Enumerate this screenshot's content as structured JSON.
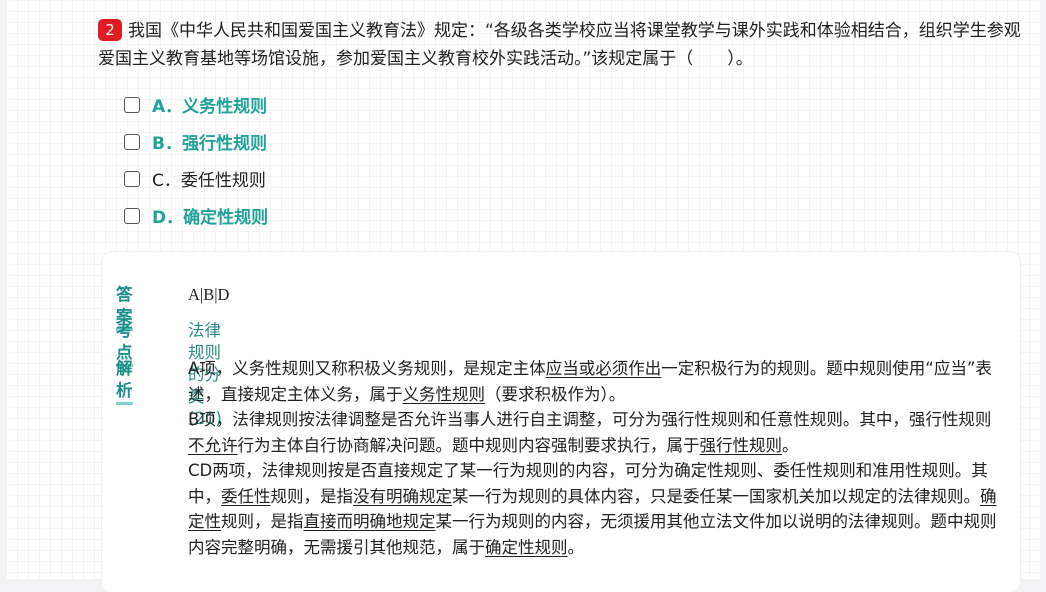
{
  "question": {
    "number": "2",
    "text": "我国《中华人民共和国爱国主义教育法》规定：“各级各类学校应当将课堂教学与课外实践和体验相结合，组织学生参观爱国主义教育基地等场馆设施，参加爱国主义教育校外实践活动。”该规定属于（　　）。"
  },
  "options": [
    {
      "label": "A．义务性规则",
      "correct": true
    },
    {
      "label": "B．强行性规则",
      "correct": true
    },
    {
      "label": "C．委任性规则",
      "correct": false
    },
    {
      "label": "D．确定性规则",
      "correct": true
    }
  ],
  "answer_card": {
    "answer_label": "答案",
    "answer_value": "A|B|D",
    "point_label": "考点",
    "point_value": "法律规则的分类(20)",
    "explain_label": "解析",
    "explain": {
      "p1_a": "A项，义务性规则又称积极义务规则，是规定主体",
      "p1_u1": "应当或必须作出",
      "p1_b": "一定积极行为的规则。题中规则使用“应当”表述，直接规定主体义务，属于",
      "p1_u2": "义务性规则",
      "p1_c": "（要求积极作为）。",
      "p2_a": "B项，法律规则按法律调整是否允许当事人进行自主调整，可分为强行性规则和任意性规则。其中，强行性规则",
      "p2_u1": "不允许",
      "p2_b": "行为主体自行协商解决问题。题中规则内容强制要求执行，属于",
      "p2_u2": "强行性规则",
      "p2_c": "。",
      "p3_a": "CD两项，法律规则按是否直接规定了某一行为规则的内容，可分为确定性规则、委任性规则和准用性规则。其中，",
      "p3_u1": "委任性",
      "p3_b": "规则，是指",
      "p3_u2": "没有明确规定",
      "p3_c": "某一行为规则的具体内容，只是委任某一国家机关加以规定的法律规则。",
      "p3_u3": "确定性",
      "p3_d": "规则，是指",
      "p3_u4": "直接而明确地规定",
      "p3_e": "某一行为规则的内容，无须援用其他立法文件加以说明的法律规则。题中规则内容完整明确，无需援引其他规范，属于",
      "p3_u5": "确定性规则",
      "p3_f": "。"
    }
  },
  "colors": {
    "correct": "#21a29a",
    "badge": "#e01b24",
    "label": "#1a8f8a"
  }
}
